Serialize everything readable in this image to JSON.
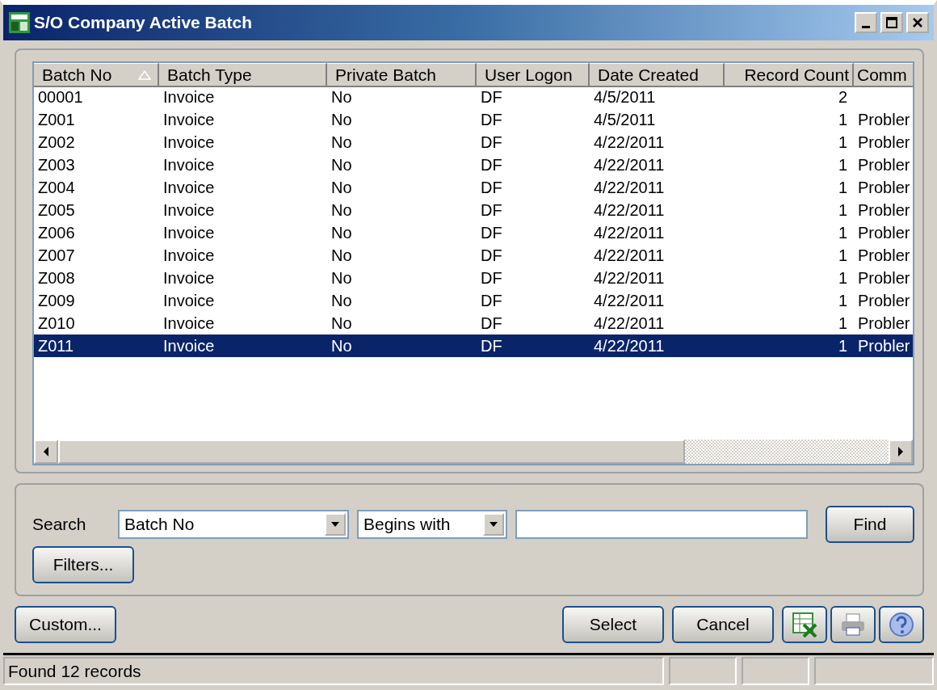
{
  "window": {
    "title": "S/O Company Active Batch"
  },
  "table": {
    "columns": [
      {
        "label": "Batch No",
        "sorted": true
      },
      {
        "label": "Batch Type",
        "sorted": false
      },
      {
        "label": "Private Batch",
        "sorted": false
      },
      {
        "label": "User Logon",
        "sorted": false
      },
      {
        "label": "Date Created",
        "sorted": false
      },
      {
        "label": "Record Count",
        "sorted": false
      },
      {
        "label": "Comm",
        "sorted": false
      }
    ],
    "rows": [
      {
        "cells": [
          "00001",
          "Invoice",
          "No",
          "DF",
          "4/5/2011",
          "2",
          ""
        ],
        "selected": false
      },
      {
        "cells": [
          "Z001",
          "Invoice",
          "No",
          "DF",
          "4/5/2011",
          "1",
          "Probler"
        ],
        "selected": false
      },
      {
        "cells": [
          "Z002",
          "Invoice",
          "No",
          "DF",
          "4/22/2011",
          "1",
          "Probler"
        ],
        "selected": false
      },
      {
        "cells": [
          "Z003",
          "Invoice",
          "No",
          "DF",
          "4/22/2011",
          "1",
          "Probler"
        ],
        "selected": false
      },
      {
        "cells": [
          "Z004",
          "Invoice",
          "No",
          "DF",
          "4/22/2011",
          "1",
          "Probler"
        ],
        "selected": false
      },
      {
        "cells": [
          "Z005",
          "Invoice",
          "No",
          "DF",
          "4/22/2011",
          "1",
          "Probler"
        ],
        "selected": false
      },
      {
        "cells": [
          "Z006",
          "Invoice",
          "No",
          "DF",
          "4/22/2011",
          "1",
          "Probler"
        ],
        "selected": false
      },
      {
        "cells": [
          "Z007",
          "Invoice",
          "No",
          "DF",
          "4/22/2011",
          "1",
          "Probler"
        ],
        "selected": false
      },
      {
        "cells": [
          "Z008",
          "Invoice",
          "No",
          "DF",
          "4/22/2011",
          "1",
          "Probler"
        ],
        "selected": false
      },
      {
        "cells": [
          "Z009",
          "Invoice",
          "No",
          "DF",
          "4/22/2011",
          "1",
          "Probler"
        ],
        "selected": false
      },
      {
        "cells": [
          "Z010",
          "Invoice",
          "No",
          "DF",
          "4/22/2011",
          "1",
          "Probler"
        ],
        "selected": false
      },
      {
        "cells": [
          "Z011",
          "Invoice",
          "No",
          "DF",
          "4/22/2011",
          "1",
          "Probler"
        ],
        "selected": true
      }
    ]
  },
  "search": {
    "label": "Search",
    "field": "Batch No",
    "operator": "Begins with",
    "find": "Find",
    "filters": "Filters..."
  },
  "buttons": {
    "custom": "Custom...",
    "select": "Select",
    "cancel": "Cancel"
  },
  "status_bar": {
    "message": "Found 12 records"
  }
}
